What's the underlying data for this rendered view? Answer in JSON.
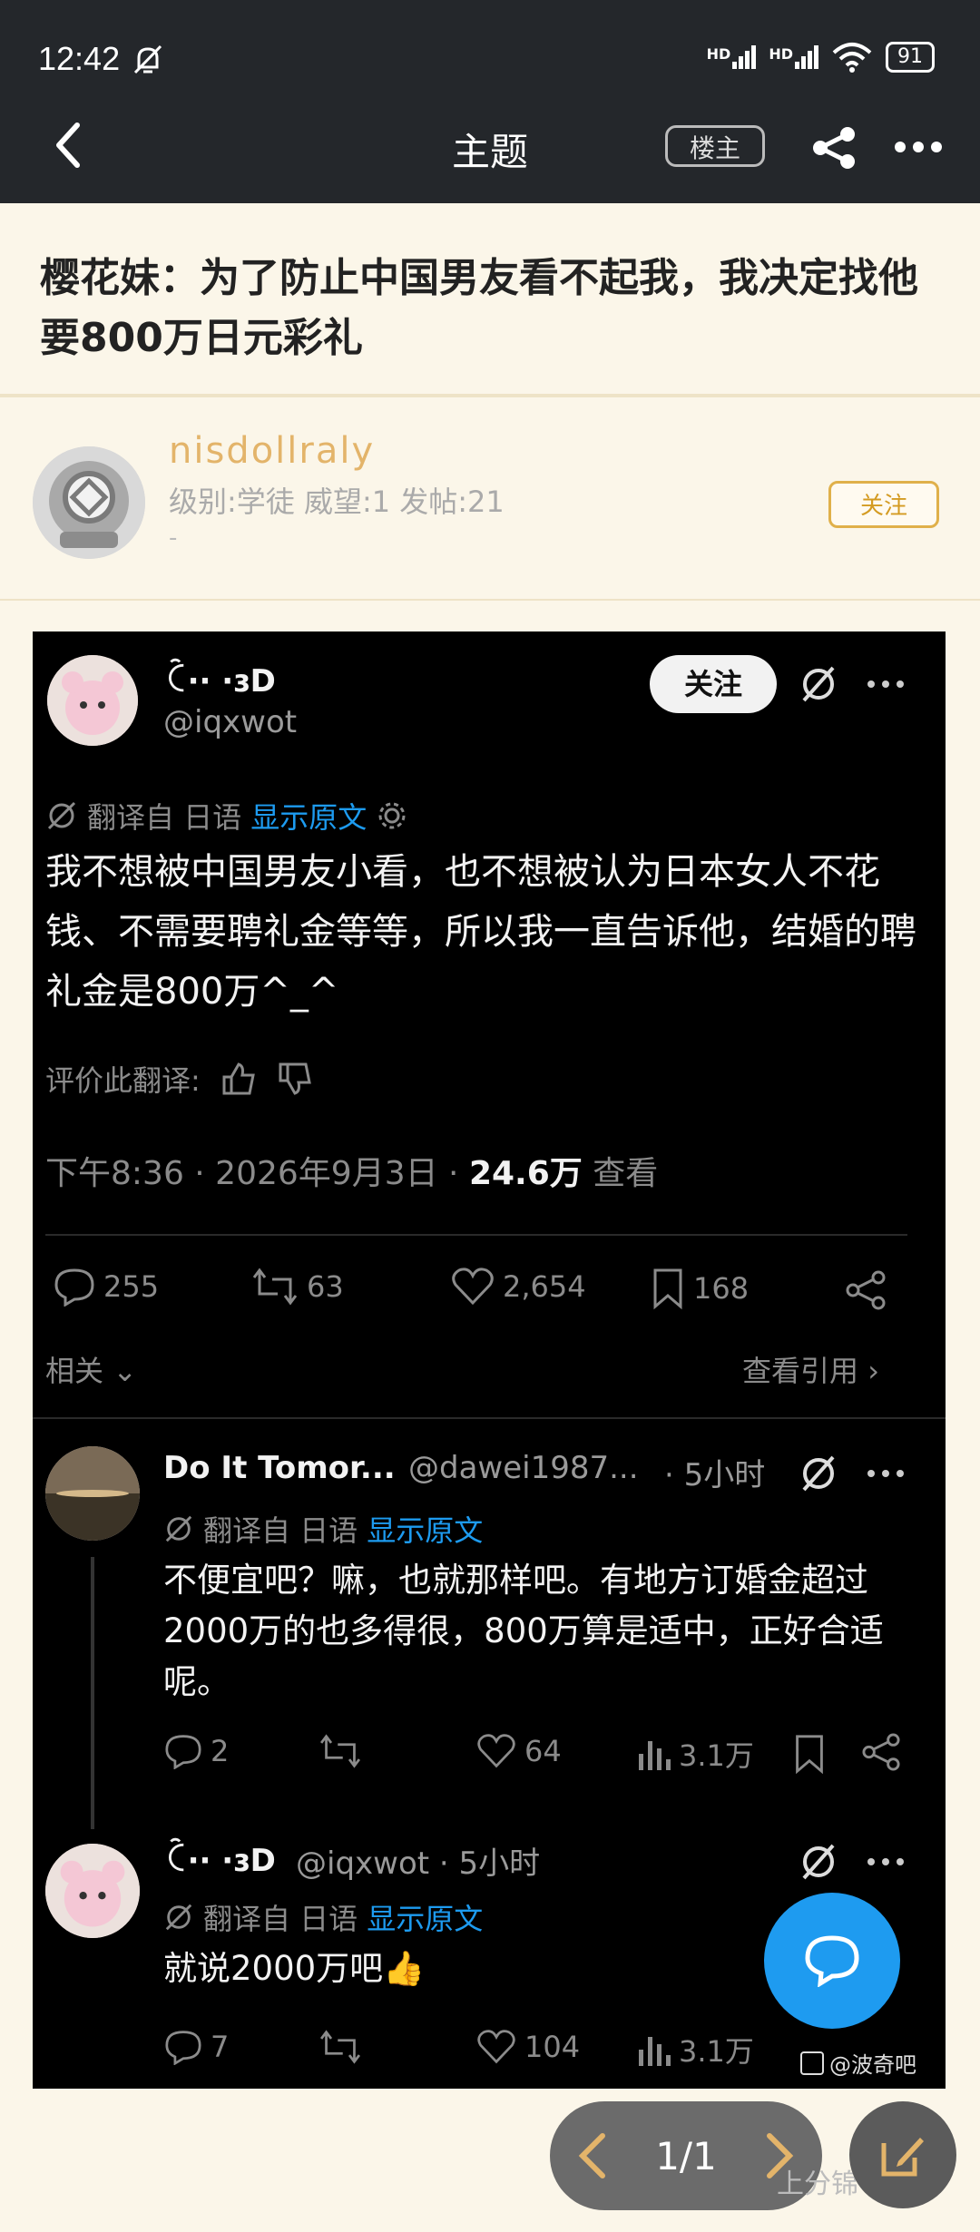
{
  "status": {
    "time": "12:42",
    "net1": "HD",
    "net2": "HD",
    "battery": "91"
  },
  "nav": {
    "title": "主题",
    "floor_button": "楼主"
  },
  "post": {
    "title": "樱花妹：为了防止中国男友看不起我，我决定找他要800万日元彩礼"
  },
  "author": {
    "name": "nisdollraly",
    "meta": "级别:学徒 威望:1 发帖:21",
    "extra": "-",
    "follow": "关注"
  },
  "tweet": {
    "name": "ꉓ·· ·ɜD",
    "handle": "@iqxwot",
    "follow": "关注",
    "translated_from": "翻译自 日语",
    "show_original": "显示原文",
    "text": "我不想被中国男友小看，也不想被认为日本女人不花钱、不需要聘礼金等等，所以我一直告诉他，结婚的聘礼金是800万^_^",
    "rate": "评价此翻译:",
    "time": "下午8:36 · 2026年9月3日 · ",
    "views_num": "24.6万",
    "views_label": " 查看",
    "replies": "255",
    "retweets": "63",
    "likes": "2,654",
    "bookmarks": "168",
    "related": "相关",
    "quotes": "查看引用"
  },
  "reply1": {
    "name": "Do It Tomor...",
    "handle": "@dawei1987...",
    "time": "· 5小时",
    "translated_from": "翻译自 日语",
    "show_original": "显示原文",
    "text": "不便宜吧？嘛，也就那样吧。有地方订婚金超过2000万的也多得很，800万算是适中，正好合适呢。",
    "replies": "2",
    "likes": "64",
    "views": "3.1万"
  },
  "reply2": {
    "name": "ꉓ·· ·ɜD",
    "handle": "@iqxwot · 5小时",
    "translated_from": "翻译自 日语",
    "show_original": "显示原文",
    "text": "就说2000万吧👍",
    "replies": "7",
    "likes": "104",
    "views": "3.1万"
  },
  "watermark": "@波奇吧",
  "pager": {
    "text": "1/1"
  },
  "footer_watermark": "上分锦"
}
